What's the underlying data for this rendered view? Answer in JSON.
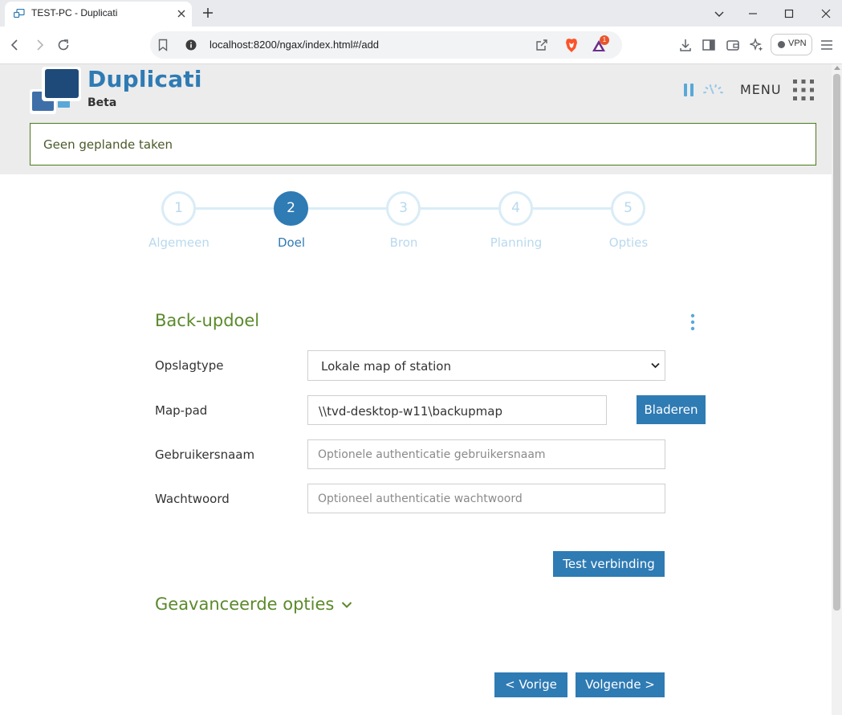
{
  "browser": {
    "tab_title": "TEST-PC - Duplicati",
    "url": "localhost:8200/ngax/index.html#/add",
    "rewards_badge": "1",
    "vpn_label": "VPN"
  },
  "app": {
    "title": "Duplicati",
    "subtitle": "Beta",
    "menu_label": "MENU",
    "status_text": "Geen geplande taken"
  },
  "steps": [
    {
      "number": "1",
      "label": "Algemeen",
      "active": false
    },
    {
      "number": "2",
      "label": "Doel",
      "active": true
    },
    {
      "number": "3",
      "label": "Bron",
      "active": false
    },
    {
      "number": "4",
      "label": "Planning",
      "active": false
    },
    {
      "number": "5",
      "label": "Opties",
      "active": false
    }
  ],
  "form": {
    "section_title": "Back-updoel",
    "storage_type_label": "Opslagtype",
    "storage_type_value": "Lokale map of station",
    "path_label": "Map-pad",
    "path_value": "\\\\tvd-desktop-w11\\backupmap",
    "browse_label": "Bladeren",
    "username_label": "Gebruikersnaam",
    "username_placeholder": "Optionele authenticatie gebruikersnaam",
    "password_label": "Wachtwoord",
    "password_placeholder": "Optioneel authenticatie wachtwoord",
    "test_label": "Test verbinding",
    "advanced_label": "Geavanceerde opties",
    "prev_label": "< Vorige",
    "next_label": "Volgende >"
  },
  "colors": {
    "accent": "#2f7bb4",
    "section_green": "#5a8a2b",
    "step_inactive": "#b8d9ee"
  }
}
